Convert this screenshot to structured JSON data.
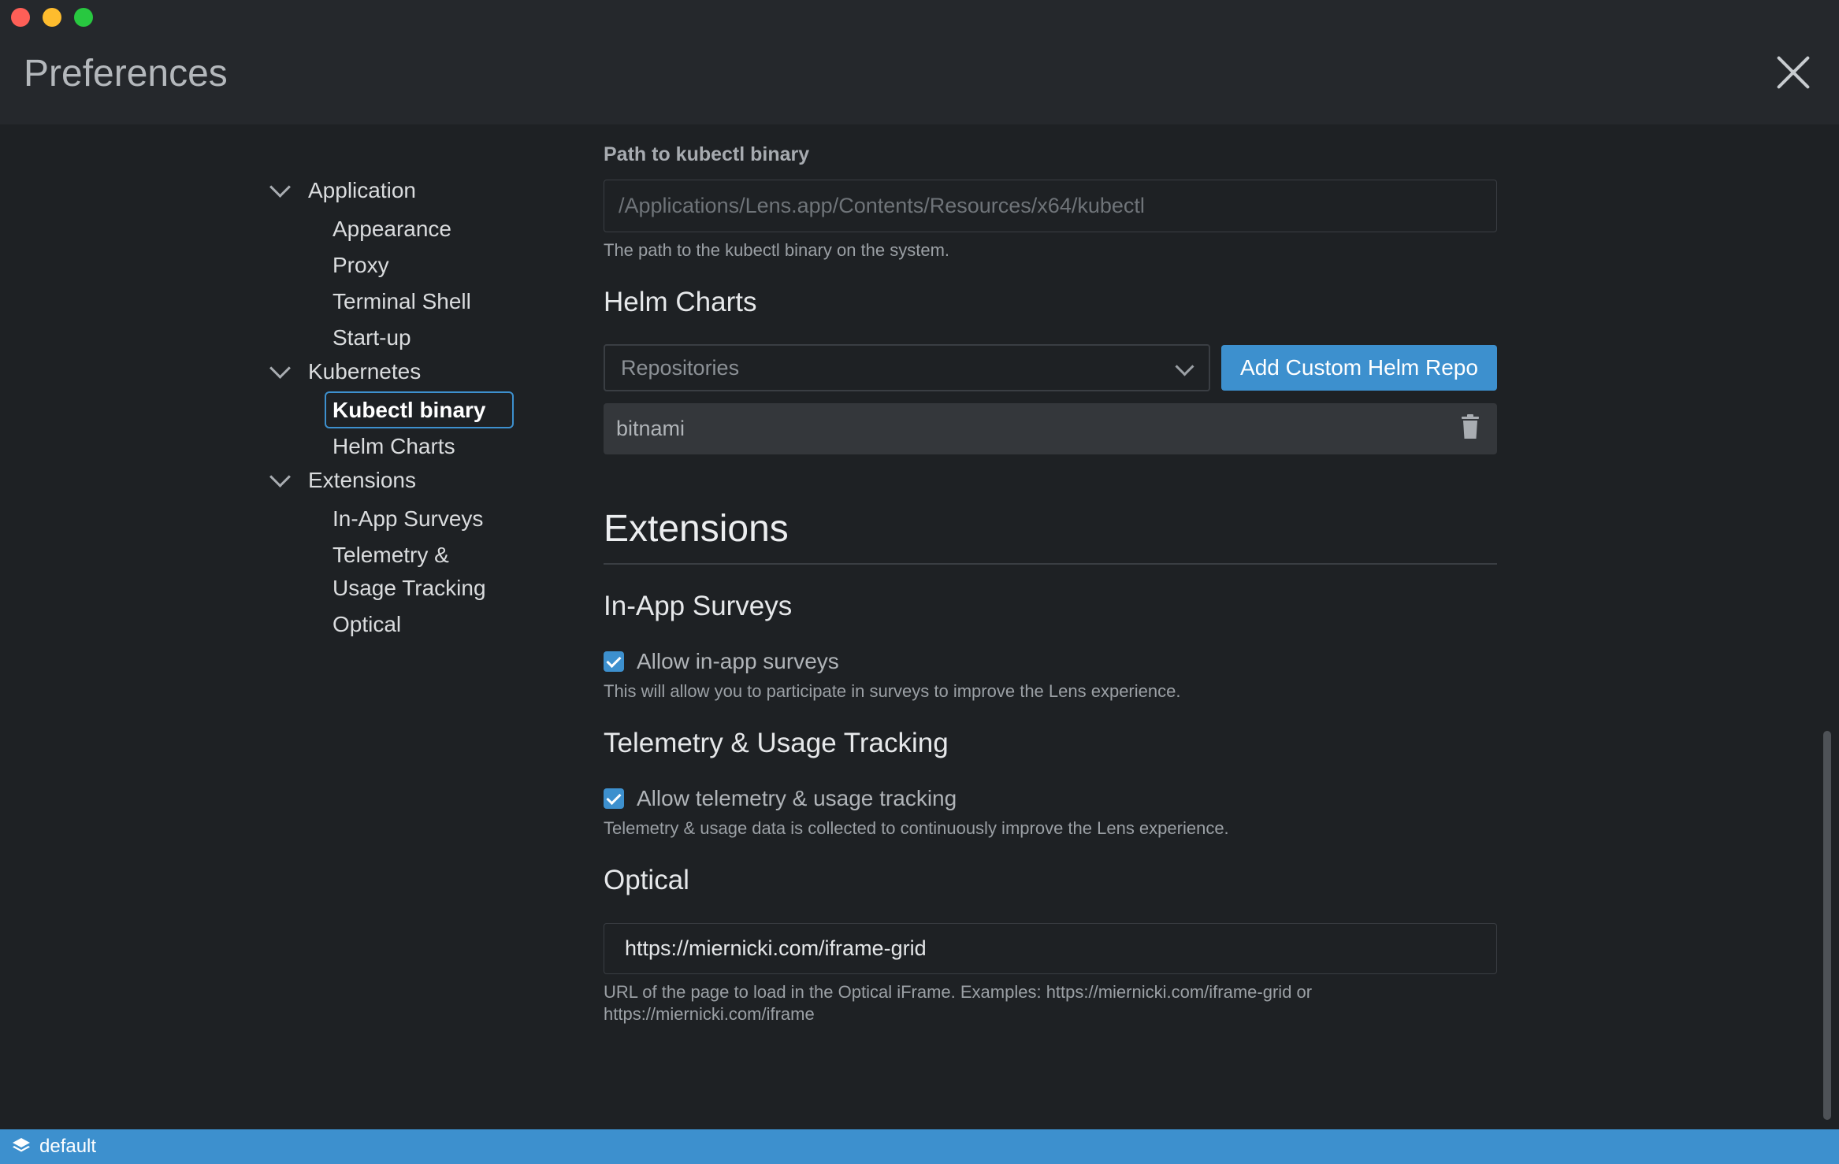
{
  "window": {
    "title": "Preferences"
  },
  "sidebar": {
    "groups": [
      {
        "label": "Application",
        "items": [
          "Appearance",
          "Proxy",
          "Terminal Shell",
          "Start-up"
        ]
      },
      {
        "label": "Kubernetes",
        "items": [
          "Kubectl binary",
          "Helm Charts"
        ]
      },
      {
        "label": "Extensions",
        "items": [
          "In-App Surveys",
          "Telemetry &",
          "Usage Tracking",
          "Optical"
        ]
      }
    ],
    "active_item": "Kubectl binary"
  },
  "kubectl": {
    "path_label": "Path to kubectl binary",
    "path_placeholder": "/Applications/Lens.app/Contents/Resources/x64/kubectl",
    "path_hint": "The path to the kubectl binary on the system."
  },
  "helm": {
    "title": "Helm Charts",
    "select_placeholder": "Repositories",
    "add_button": "Add Custom Helm Repo",
    "repos": [
      "bitnami"
    ]
  },
  "extensions": {
    "title": "Extensions",
    "surveys": {
      "title": "In-App Surveys",
      "checkbox_label": "Allow in-app surveys",
      "checked": true,
      "hint": "This will allow you to participate in surveys to improve the Lens experience."
    },
    "telemetry": {
      "title": "Telemetry & Usage Tracking",
      "checkbox_label": "Allow telemetry & usage tracking",
      "checked": true,
      "hint": "Telemetry & usage data is collected to continuously improve the Lens experience."
    },
    "optical": {
      "title": "Optical",
      "url_value": "https://miernicki.com/iframe-grid",
      "hint_line1": "URL of the page to load in the Optical iFrame. Examples: https://miernicki.com/iframe-grid or",
      "hint_line2": "https://miernicki.com/iframe"
    }
  },
  "statusbar": {
    "context": "default"
  },
  "colors": {
    "accent": "#3d90ce",
    "background": "#1e2124",
    "titlebar": "#25282c"
  }
}
